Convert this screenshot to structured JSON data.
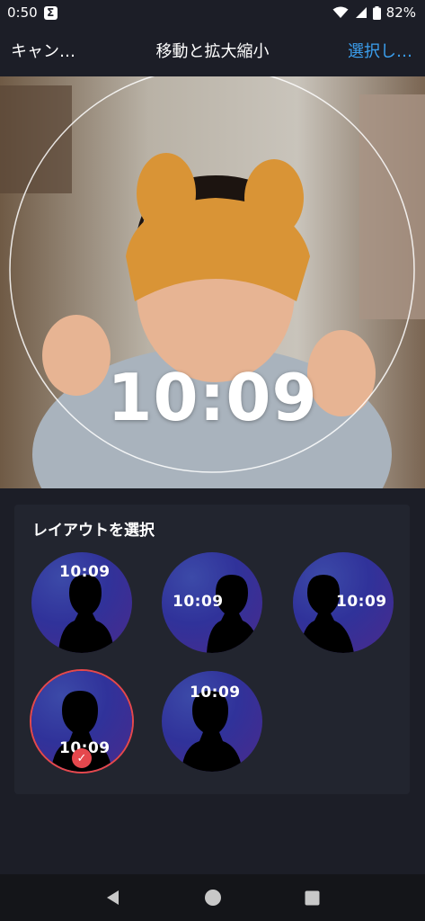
{
  "status": {
    "time": "0:50",
    "app_icon": "Σ",
    "battery": "82%",
    "icons": [
      "wifi-icon",
      "signal-icon",
      "battery-icon"
    ]
  },
  "toolbar": {
    "cancel_label": "キャン…",
    "title": "移動と拡大縮小",
    "select_label": "選択し…",
    "select_color": "#3ba0f0"
  },
  "preview": {
    "clock": "10:09"
  },
  "layout_panel": {
    "title": "レイアウトを選択",
    "options": [
      {
        "time": "10:09",
        "selected": false
      },
      {
        "time": "10:09",
        "selected": false
      },
      {
        "time": "10:09",
        "selected": false
      },
      {
        "time": "10:09",
        "selected": true
      },
      {
        "time": "10:09",
        "selected": false
      }
    ],
    "accent": "#e5484d"
  },
  "nav": {
    "buttons": [
      "back-icon",
      "home-icon",
      "recents-icon"
    ]
  }
}
